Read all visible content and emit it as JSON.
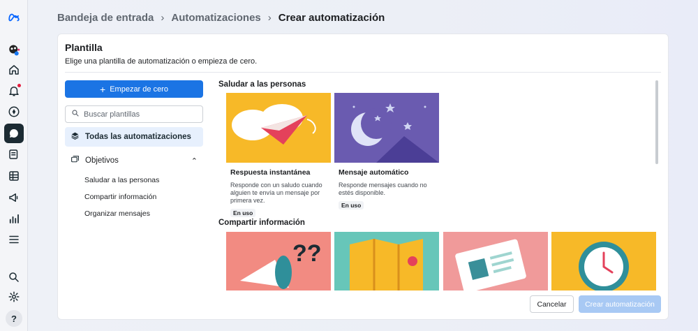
{
  "breadcrumb": {
    "items": [
      "Bandeja de entrada",
      "Automatizaciones",
      "Crear automatización"
    ]
  },
  "card": {
    "title": "Plantilla",
    "subtitle": "Elige una plantilla de automatización o empieza de cero."
  },
  "sidebar": {
    "start_button": "Empezar de cero",
    "search_placeholder": "Buscar plantillas",
    "all_label": "Todas las automatizaciones",
    "objectives_label": "Objetivos",
    "objectives_items": [
      "Saludar a las personas",
      "Compartir información",
      "Organizar mensajes"
    ]
  },
  "sections": [
    {
      "title": "Saludar a las personas",
      "templates": [
        {
          "name": "Respuesta instantánea",
          "desc": "Responde con un saludo cuando alguien te envía un mensaje por primera vez.",
          "badge": "En uso",
          "bg": "#f7b928"
        },
        {
          "name": "Mensaje automático",
          "desc": "Responde mensajes cuando no estés disponible.",
          "badge": "En uso",
          "bg": "#6a5bb0"
        }
      ]
    },
    {
      "title": "Compartir información",
      "templates": [
        {
          "bg": "#f28b82",
          "icon": "megaphone-icon"
        },
        {
          "bg": "#67c6b9",
          "icon": "map-icon"
        },
        {
          "bg": "#f09a9a",
          "icon": "id-card-icon"
        },
        {
          "bg": "#f7b928",
          "icon": "clock-icon"
        }
      ]
    }
  ],
  "footer": {
    "cancel": "Cancelar",
    "create": "Crear automatización"
  },
  "colors": {
    "primary": "#1b74e4",
    "primary_disabled": "#a8c9f4",
    "selected_bg": "#e7f0fd"
  }
}
